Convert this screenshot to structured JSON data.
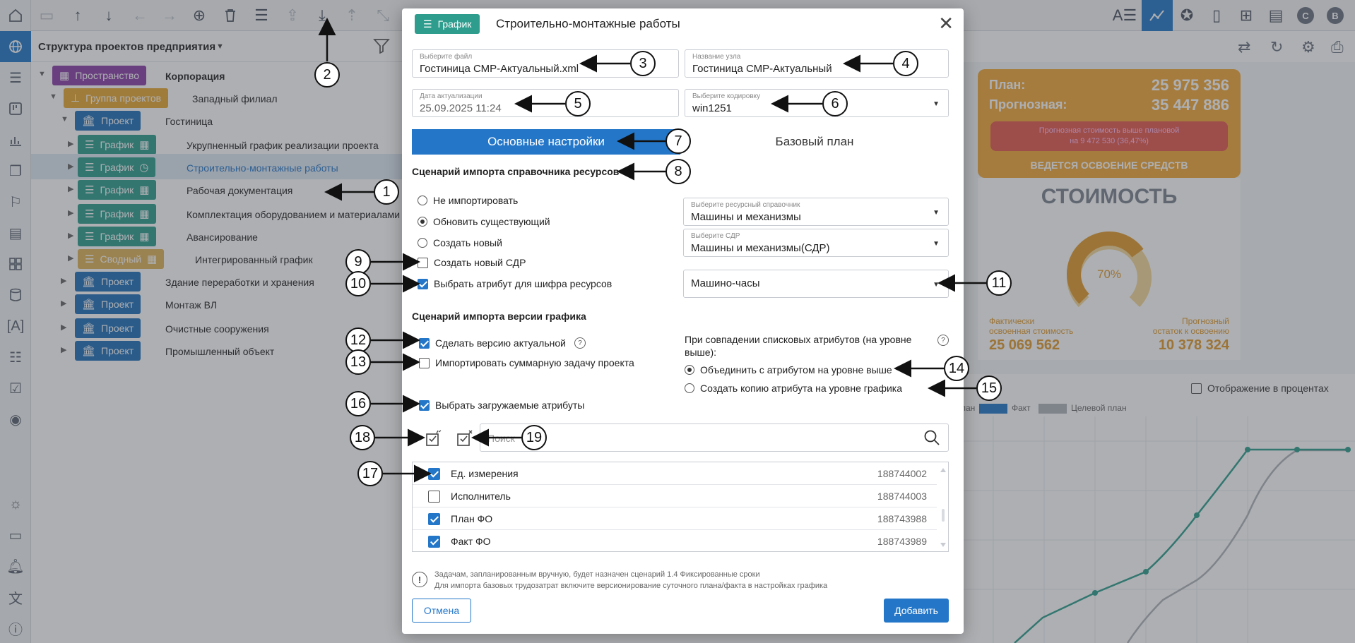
{
  "rail": {
    "items": [
      "home-icon",
      "globe-icon",
      "list-icon",
      "board-icon",
      "chart-icon",
      "layers-icon",
      "flag-icon",
      "stripes-icon",
      "grid-icon",
      "database-icon",
      "text-field-icon",
      "checklist-icon",
      "calendar-check-icon",
      "eye-icon",
      "sun-icon",
      "comment-icon",
      "bell-icon",
      "translate-icon",
      "info-icon"
    ]
  },
  "toolbar": {
    "right_letters": [
      "C",
      "B"
    ]
  },
  "tree": {
    "title": "Структура проектов предприятия",
    "rows": [
      {
        "type": "Пространство",
        "label": "Корпорация"
      },
      {
        "type": "Группа проектов",
        "label": "Западный филиал"
      },
      {
        "type": "Проект",
        "label": "Гостиница"
      },
      {
        "type": "График",
        "label": "Укрупненный график реализации проекта"
      },
      {
        "type": "График",
        "label": "Строительно-монтажные работы"
      },
      {
        "type": "График",
        "label": "Рабочая документация"
      },
      {
        "type": "График",
        "label": "Комплектация оборудованием и материалами"
      },
      {
        "type": "График",
        "label": "Авансирование"
      },
      {
        "type": "Сводный",
        "label": "Интегрированный график"
      },
      {
        "type": "Проект",
        "label": "Здание переработки и хранения"
      },
      {
        "type": "Проект",
        "label": "Монтаж ВЛ"
      },
      {
        "type": "Проект",
        "label": "Очистные сооружения"
      },
      {
        "type": "Проект",
        "label": "Промышленный объект"
      }
    ]
  },
  "kpi": {
    "plan_label": "План:",
    "plan_value": "25 975 356",
    "forecast_label": "Прогнозная:",
    "forecast_value": "35 447 886",
    "alert_line1": "Прогнозная стоимость выше плановой",
    "alert_line2": "на 9 472 530 (36,47%)",
    "status": "ВЕДЕТСЯ ОСВОЕНИЕ СРЕДСТВ",
    "accent": "#f2a838"
  },
  "cost": {
    "title": "СТОИМОСТЬ",
    "percent": 70,
    "percent_label": "70%",
    "fact_label_1": "Фактически",
    "fact_label_2": "освоенная стоимость",
    "fact_value": "25 069 562",
    "rest_label_1": "Прогнозный",
    "rest_label_2": "остаток к освоению",
    "rest_value": "10 378 324"
  },
  "chart": {
    "pct_toggle": "Отображение в процентах",
    "legend": [
      {
        "name": "Факт",
        "color": "#2477c8"
      },
      {
        "name": "Целевой план",
        "color": "#b0b4ba"
      }
    ],
    "legend_partial": "лан"
  },
  "dialog": {
    "chip_label": "График",
    "title": "Строительно-монтажные работы",
    "file": {
      "label": "Выберите файл",
      "value": "Гостиница СМР-Актуальный.xml"
    },
    "node": {
      "label": "Название узла",
      "value": "Гостиница СМР-Актуальный"
    },
    "date": {
      "label": "Дата актуализации",
      "value": "25.09.2025 11:24"
    },
    "encoding": {
      "label": "Выберите кодировку",
      "value": "win1251"
    },
    "tabs": [
      "Основные настройки",
      "Базовый план"
    ],
    "res_section": "Сценарий импорта справочника ресурсов",
    "res_options": [
      "Не импортировать",
      "Обновить существующий",
      "Создать новый"
    ],
    "create_sdr": "Создать новый СДР",
    "choose_attr": "Выбрать атрибут для шифра ресурсов",
    "res_dict": {
      "label": "Выберите ресурсный справочник",
      "value": "Машины и механизмы"
    },
    "sdr": {
      "label": "Выберите СДР",
      "value": "Машины и механизмы(СДР)"
    },
    "attr_select": {
      "value": "Машино-часы"
    },
    "ver_section": "Сценарий импорта версии графика",
    "make_actual": "Сделать версию актуальной",
    "import_summary": "Импортировать суммарную задачу проекта",
    "match_text": "При совпадении списковых атрибутов (на уровне выше):",
    "merge_opt": "Объединить с атрибутом на уровне выше",
    "copy_opt": "Создать копию атрибута на уровне графика",
    "choose_loaded": "Выбрать загружаемые атрибуты",
    "search_placeholder": "Поиск",
    "attributes": [
      {
        "name": "Ед. измерения",
        "id": "188744002",
        "checked": true
      },
      {
        "name": "Исполнитель",
        "id": "188744003",
        "checked": false
      },
      {
        "name": "План ФО",
        "id": "188743988",
        "checked": true
      },
      {
        "name": "Факт ФО",
        "id": "188743989",
        "checked": true
      }
    ],
    "note_line1": "Задачам, запланированным вручную, будет назначен сценарий 1.4 Фиксированные сроки",
    "note_line2": "Для импорта базовых трудозатрат включите версионирование суточного плана/факта в настройках графика",
    "cancel": "Отмена",
    "add": "Добавить",
    "accent": "#2477c8"
  },
  "callouts": [
    "1",
    "2",
    "3",
    "4",
    "5",
    "6",
    "7",
    "8",
    "9",
    "10",
    "11",
    "12",
    "13",
    "14",
    "15",
    "16",
    "17",
    "18",
    "19"
  ]
}
